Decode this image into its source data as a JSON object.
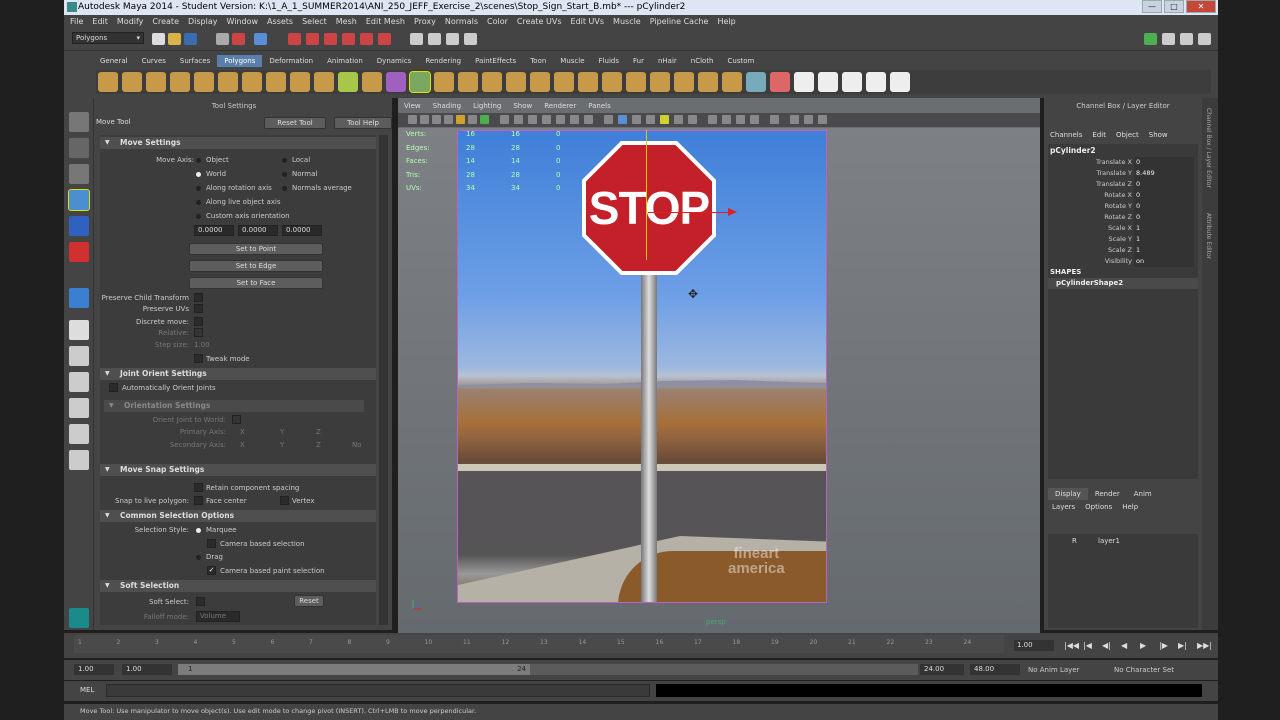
{
  "window": {
    "title": "Autodesk Maya 2014 - Student Version: K:\\1_A_1_SUMMER2014\\ANI_250_JEFF_Exercise_2\\scenes\\Stop_Sign_Start_B.mb*   ---   pCylinder2",
    "minimize": "—",
    "maximize": "□",
    "close": "✕"
  },
  "menubar": [
    "File",
    "Edit",
    "Modify",
    "Create",
    "Display",
    "Window",
    "Assets",
    "Select",
    "Mesh",
    "Edit Mesh",
    "Proxy",
    "Normals",
    "Color",
    "Create UVs",
    "Edit UVs",
    "Muscle",
    "Pipeline Cache",
    "Help"
  ],
  "toolbar": {
    "mode": "Polygons"
  },
  "shelf": {
    "tabs": [
      "General",
      "Curves",
      "Surfaces",
      "Polygons",
      "Deformation",
      "Animation",
      "Dynamics",
      "Rendering",
      "PaintEffects",
      "Toon",
      "Muscle",
      "Fluids",
      "Fur",
      "nHair",
      "nCloth",
      "Custom"
    ],
    "active_tab": "Polygons"
  },
  "tool_settings": {
    "title": "Tool Settings",
    "tool_name": "Move Tool",
    "reset_button": "Reset Tool",
    "help_button": "Tool Help",
    "move_settings": {
      "header": "Move Settings",
      "move_axis_label": "Move Axis:",
      "options": [
        "Object",
        "World",
        "Along rotation axis",
        "Along live object axis",
        "Custom axis orientation"
      ],
      "options_right": [
        "Local",
        "Normal",
        "Normals average"
      ],
      "values": [
        "0.0000",
        "0.0000",
        "0.0000"
      ],
      "set_point": "Set to Point",
      "set_edge": "Set to Edge",
      "set_face": "Set to Face",
      "preserve_child": "Preserve Child Transform",
      "preserve_uvs": "Preserve UVs",
      "discrete_move": "Discrete move:",
      "relative": "Relative:",
      "step_size": "Step size:",
      "step_value": "1.00",
      "tweak_mode": "Tweak mode"
    },
    "joint_orient": {
      "header": "Joint Orient Settings",
      "auto_orient": "Automatically Orient Joints",
      "orientation_header": "Orientation Settings",
      "orient_joint": "Orient Joint to World:",
      "primary_axis": "Primary Axis:",
      "secondary_axis": "Secondary Axis:",
      "axis_labels": [
        "X",
        "Y",
        "Z"
      ],
      "none": "No"
    },
    "move_snap": {
      "header": "Move Snap Settings",
      "retain_spacing": "Retain component spacing",
      "snap_live": "Snap to live polygon:",
      "face_center": "Face center",
      "vertex": "Vertex"
    },
    "common_selection": {
      "header": "Common Selection Options",
      "selection_style": "Selection Style:",
      "marquee": "Marquee",
      "camera_based": "Camera based selection",
      "drag": "Drag",
      "camera_paint": "Camera based paint selection",
      "checkmark": "✓"
    },
    "soft_selection": {
      "header": "Soft Selection",
      "soft_select": "Soft Select:",
      "reset": "Reset",
      "falloff_mode": "Falloff mode:",
      "falloff_value": "Volume"
    }
  },
  "viewport": {
    "menu": [
      "View",
      "Shading",
      "Lighting",
      "Show",
      "Renderer",
      "Panels"
    ],
    "hud": [
      {
        "label": "Verts:",
        "a": "16",
        "b": "16",
        "c": "0"
      },
      {
        "label": "Edges:",
        "a": "28",
        "b": "28",
        "c": "0"
      },
      {
        "label": "Faces:",
        "a": "14",
        "b": "14",
        "c": "0"
      },
      {
        "label": "Tris:",
        "a": "28",
        "b": "28",
        "c": "0"
      },
      {
        "label": "UVs:",
        "a": "34",
        "b": "34",
        "c": "0"
      }
    ],
    "sign_text": "STOP",
    "watermark_line1": "fineart",
    "watermark_line2": "america",
    "camera": "persp",
    "cursor": "✥"
  },
  "channel_box": {
    "title": "Channel Box / Layer Editor",
    "menu": [
      "Channels",
      "Edit",
      "Object",
      "Show"
    ],
    "object": "pCylinder2",
    "attributes": [
      {
        "name": "Translate X",
        "value": "0"
      },
      {
        "name": "Translate Y",
        "value": "8.489"
      },
      {
        "name": "Translate Z",
        "value": "0"
      },
      {
        "name": "Rotate X",
        "value": "0"
      },
      {
        "name": "Rotate Y",
        "value": "0"
      },
      {
        "name": "Rotate Z",
        "value": "0"
      },
      {
        "name": "Scale X",
        "value": "1"
      },
      {
        "name": "Scale Y",
        "value": "1"
      },
      {
        "name": "Scale Z",
        "value": "1"
      },
      {
        "name": "Visibility",
        "value": "on"
      }
    ],
    "shapes_label": "SHAPES",
    "shape": "pCylinderShape2",
    "layer_tabs": [
      "Display",
      "Render",
      "Anim"
    ],
    "layer_menu": [
      "Layers",
      "Options",
      "Help"
    ],
    "layer_r": "R",
    "layer_name": "layer1",
    "side_tabs": [
      "Channel Box / Layer Editor",
      "Attribute Editor"
    ]
  },
  "timeline": {
    "ticks": [
      "1",
      "2",
      "3",
      "4",
      "5",
      "6",
      "7",
      "8",
      "9",
      "10",
      "11",
      "12",
      "13",
      "14",
      "15",
      "16",
      "17",
      "18",
      "19",
      "20",
      "21",
      "22",
      "23",
      "24"
    ],
    "current": "1.00",
    "start": "1.00",
    "start2": "1.00",
    "range_start": "1",
    "range_end": "24",
    "end": "24.00",
    "end2": "48.00",
    "anim_layer": "No Anim Layer",
    "character_set": "No Character Set",
    "playback": [
      "|◀◀",
      "|◀",
      "◀|",
      "◀",
      "▶",
      "|▶",
      "▶|",
      "▶▶|"
    ]
  },
  "command": {
    "mel": "MEL"
  },
  "help_line": "Move Tool: Use manipulator to move object(s). Use edit mode to change pivot (INSERT). Ctrl+LMB to move perpendicular."
}
